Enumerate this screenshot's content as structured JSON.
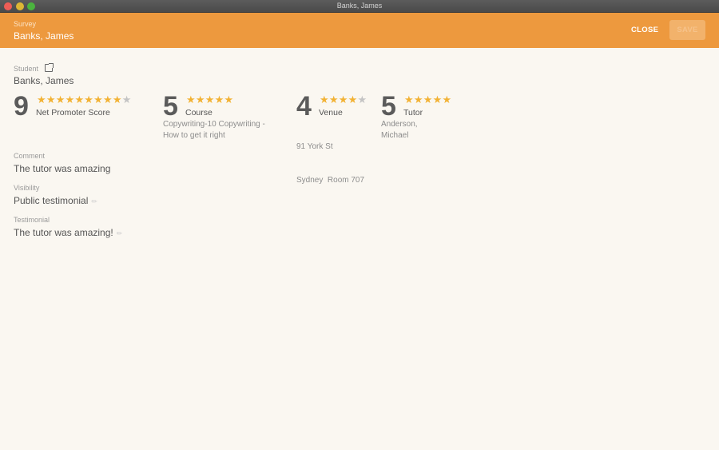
{
  "window": {
    "title": "Banks, James"
  },
  "header": {
    "subtitle": "Survey",
    "title": "Banks, James",
    "close_label": "CLOSE",
    "save_label": "SAVE"
  },
  "student": {
    "label": "Student",
    "name": "Banks, James",
    "link_icon": "external-link-icon"
  },
  "ratings": [
    {
      "key": "nps",
      "score": "9",
      "label": "Net Promoter Score",
      "filled": 9,
      "total": 10,
      "sub": []
    },
    {
      "key": "course",
      "score": "5",
      "label": "Course",
      "filled": 5,
      "total": 5,
      "sub": [
        "Copywriting-10 Copywriting -",
        "How to get it right"
      ]
    },
    {
      "key": "venue",
      "score": "4",
      "label": "Venue",
      "filled": 4,
      "total": 5,
      "sub": [
        "91 York St",
        "Sydney  Room 707"
      ]
    },
    {
      "key": "tutor",
      "score": "5",
      "label": "Tutor",
      "filled": 5,
      "total": 5,
      "sub": [
        "Anderson,",
        "Michael"
      ]
    }
  ],
  "fields": {
    "comment": {
      "label": "Comment",
      "value": "The tutor was amazing"
    },
    "visibility": {
      "label": "Visibility",
      "value": "Public testimonial",
      "icon": "pencil-icon"
    },
    "testimonial": {
      "label": "Testimonial",
      "value": "The tutor was amazing!",
      "icon": "pencil-icon"
    }
  },
  "colors": {
    "accent": "#ed993e",
    "star_on": "#f2b234",
    "star_off": "#c4c4c4"
  }
}
